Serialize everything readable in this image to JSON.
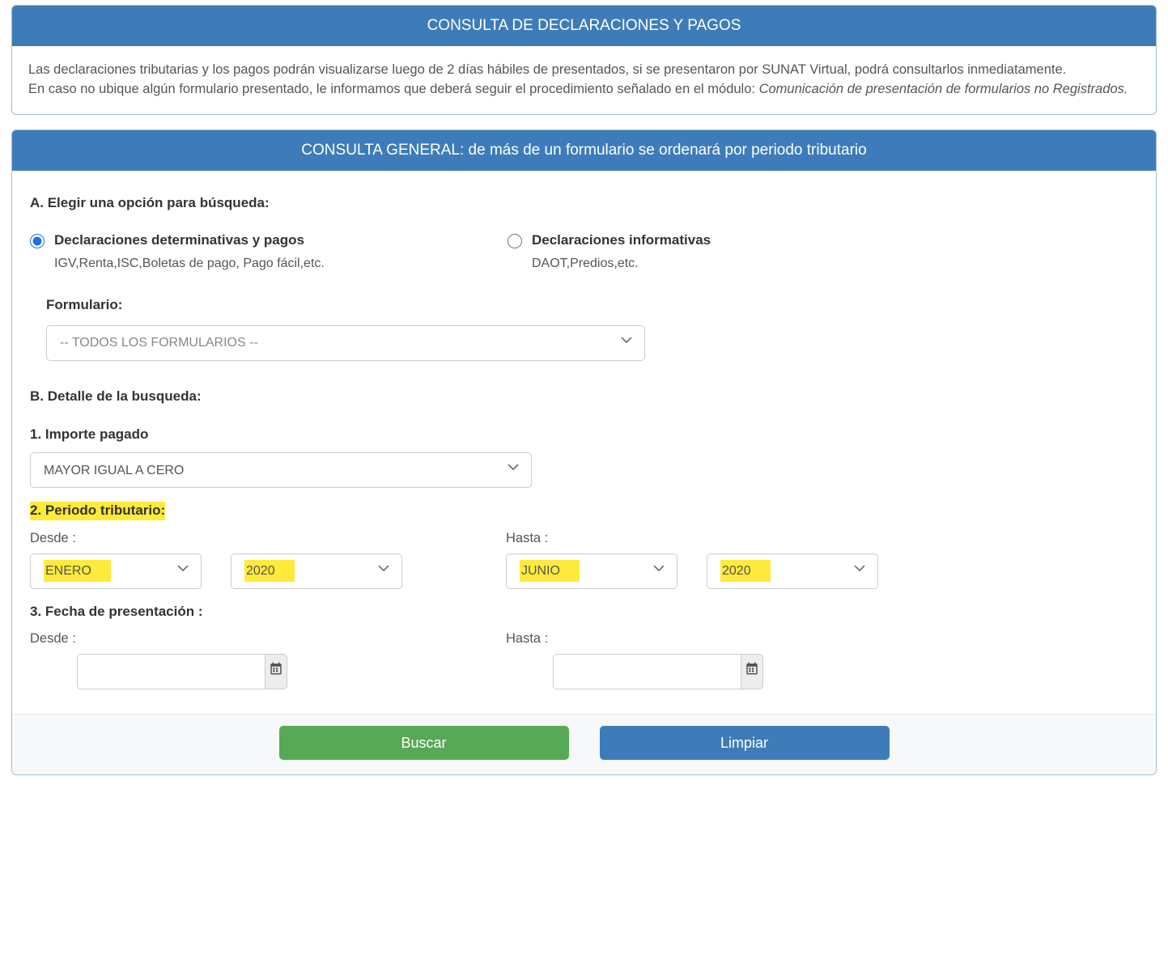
{
  "panel1": {
    "title": "CONSULTA DE DECLARACIONES Y PAGOS",
    "p1": "Las declaraciones tributarias y los pagos podrán visualizarse luego de 2 días hábiles de presentados, si se presentaron por SUNAT Virtual, podrá consultarlos inmediatamente.",
    "p2a": "En caso no ubique algún formulario presentado, le informamos que deberá seguir el procedimiento señalado en el módulo: ",
    "p2b": "Comunicación de presentación de formularios no Registrados."
  },
  "panel2": {
    "title": "CONSULTA GENERAL: de más de un formulario se ordenará por periodo tributario",
    "sectionA": {
      "heading": "A. Elegir una opción para búsqueda:",
      "opt1": {
        "label": "Declaraciones determinativas y pagos",
        "sub": "IGV,Renta,ISC,Boletas de pago, Pago fácil,etc."
      },
      "opt2": {
        "label": "Declaraciones informativas",
        "sub": "DAOT,Predios,etc."
      },
      "formularioLabel": "Formulario:",
      "formularioValue": "-- TODOS LOS FORMULARIOS --"
    },
    "sectionB": {
      "heading": "B. Detalle de la busqueda:",
      "importe": {
        "label": "1. Importe pagado",
        "value": "MAYOR IGUAL A CERO"
      },
      "periodo": {
        "label": "2. Periodo tributario:",
        "desdeLabel": "Desde :",
        "hastaLabel": "Hasta :",
        "desdeMes": "ENERO",
        "desdeAnio": "2020",
        "hastaMes": "JUNIO",
        "hastaAnio": "2020"
      },
      "fecha": {
        "label": "3. Fecha de presentación :",
        "desdeLabel": "Desde :",
        "hastaLabel": "Hasta :"
      }
    },
    "buttons": {
      "buscar": "Buscar",
      "limpiar": "Limpiar"
    }
  }
}
